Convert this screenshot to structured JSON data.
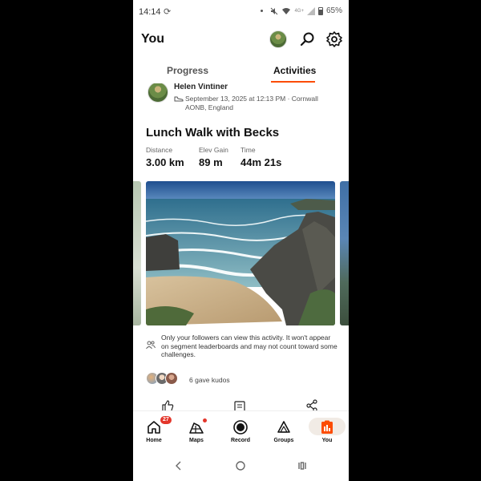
{
  "status_bar": {
    "time": "14:14",
    "battery": "65%",
    "signal_text": "4G+"
  },
  "header": {
    "title": "You"
  },
  "tabs": [
    {
      "label": "Progress"
    },
    {
      "label": "Activities"
    }
  ],
  "activity": {
    "athlete_name": "Helen Vintiner",
    "meta": "September 13, 2025 at 12:13 PM · Cornwall AONB, England",
    "title": "Lunch Walk with Becks",
    "stats": [
      {
        "label": "Distance",
        "value": "3.00 km"
      },
      {
        "label": "Elev Gain",
        "value": "89 m"
      },
      {
        "label": "Time",
        "value": "44m 21s"
      }
    ],
    "privacy_notice": "Only your followers can view this activity. It won't appear on segment leaderboards and may not count toward some challenges.",
    "kudos_text": "6 gave kudos"
  },
  "bottom_nav": [
    {
      "label": "Home",
      "badge": "27"
    },
    {
      "label": "Maps"
    },
    {
      "label": "Record"
    },
    {
      "label": "Groups"
    },
    {
      "label": "You"
    }
  ],
  "colors": {
    "accent": "#fc4c02",
    "badge": "#e3362b"
  }
}
